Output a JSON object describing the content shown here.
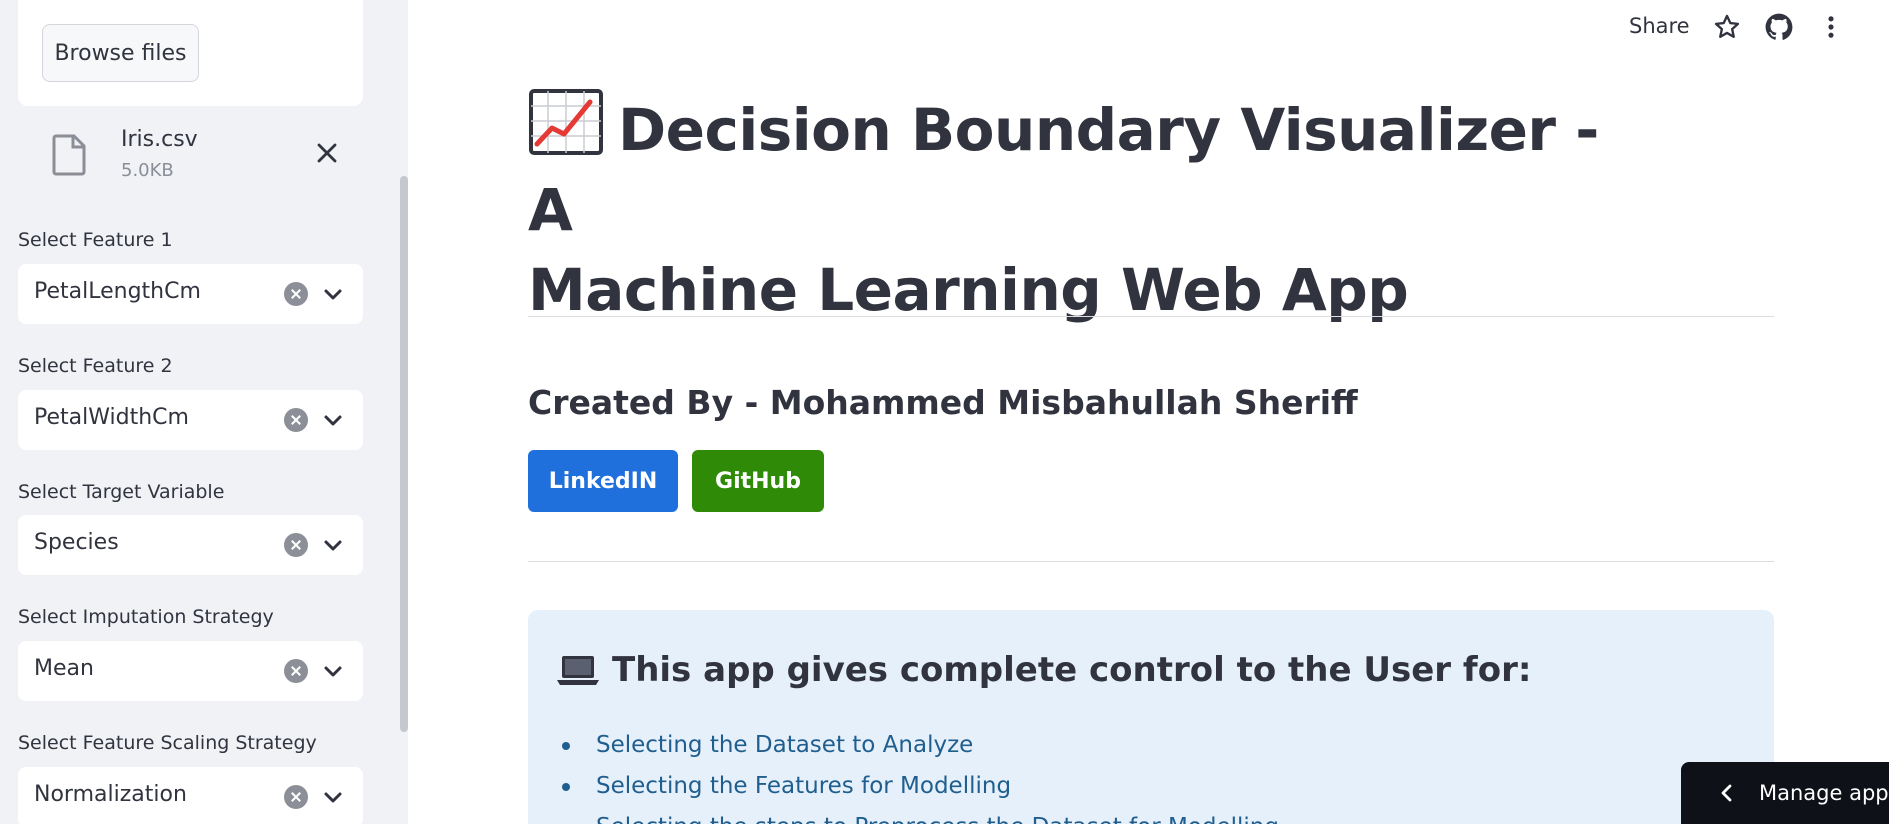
{
  "sidebar": {
    "uploader": {
      "browse_label": "Browse files"
    },
    "file": {
      "name": "Iris.csv",
      "size": "5.0KB"
    },
    "fields": [
      {
        "label": "Select Feature 1",
        "value": "PetalLengthCm"
      },
      {
        "label": "Select Feature 2",
        "value": "PetalWidthCm"
      },
      {
        "label": "Select Target Variable",
        "value": "Species"
      },
      {
        "label": "Select Imputation Strategy",
        "value": "Mean"
      },
      {
        "label": "Select Feature Scaling Strategy",
        "value": "Normalization"
      }
    ]
  },
  "topbar": {
    "share_label": "Share",
    "icons": [
      "star-icon",
      "github-icon",
      "more-vertical-icon"
    ]
  },
  "main": {
    "title_line1": "Decision Boundary Visualizer - A",
    "title_line2": "Machine Learning Web App",
    "created_by": "Created By - Mohammed Misbahullah Sheriff",
    "buttons": {
      "linkedin": "LinkedIN",
      "github": "GitHub"
    },
    "info": {
      "heading": "This app gives complete control to the User for:",
      "items": [
        "Selecting the Dataset to Analyze",
        "Selecting the Features for Modelling",
        "Selecting the steps to Preprocess the Dataset for Modelling"
      ]
    }
  },
  "manage_app": {
    "label": "Manage app"
  },
  "colors": {
    "linkedin": "#1f6fdc",
    "github": "#2e8a07",
    "info_bg": "#e6f0fa",
    "sidebar_bg": "#f0f2f6"
  }
}
